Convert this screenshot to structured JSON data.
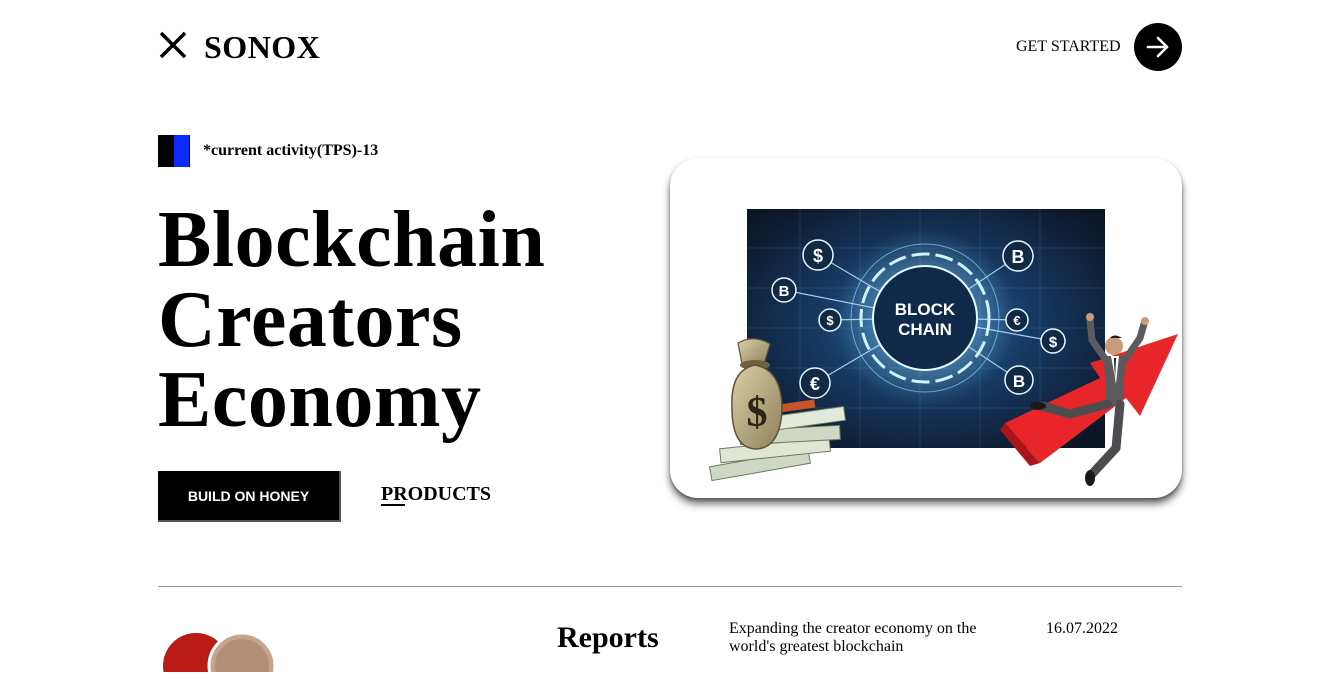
{
  "header": {
    "brand": "SONOX",
    "cta_label": "GET STARTED",
    "logo_icon": "x-cross-icon",
    "cta_icon": "arrow-right-icon"
  },
  "activity": {
    "text": "*current activity(TPS)-13",
    "icon_colors": [
      "#000000",
      "#0d2bff"
    ]
  },
  "hero": {
    "title_lines": [
      "Blockchain",
      "Creators",
      "Economy"
    ],
    "primary_button": "BUILD ON HONEY",
    "secondary_link": "PRODUCTS",
    "image": {
      "center_label": [
        "BLOCK",
        "CHAIN"
      ],
      "coin_symbols": [
        "$",
        "B",
        "$",
        "€",
        "€",
        "$",
        "B",
        "B"
      ]
    }
  },
  "reports": {
    "heading": "Reports",
    "items": [
      {
        "description": "Expanding the creator economy on the world's greatest blockchain",
        "date": "16.07.2022"
      }
    ]
  },
  "colors": {
    "background": "#ffffff",
    "text": "#000000",
    "accent_blue": "#0d2bff",
    "arrow_red": "#e8262a"
  }
}
